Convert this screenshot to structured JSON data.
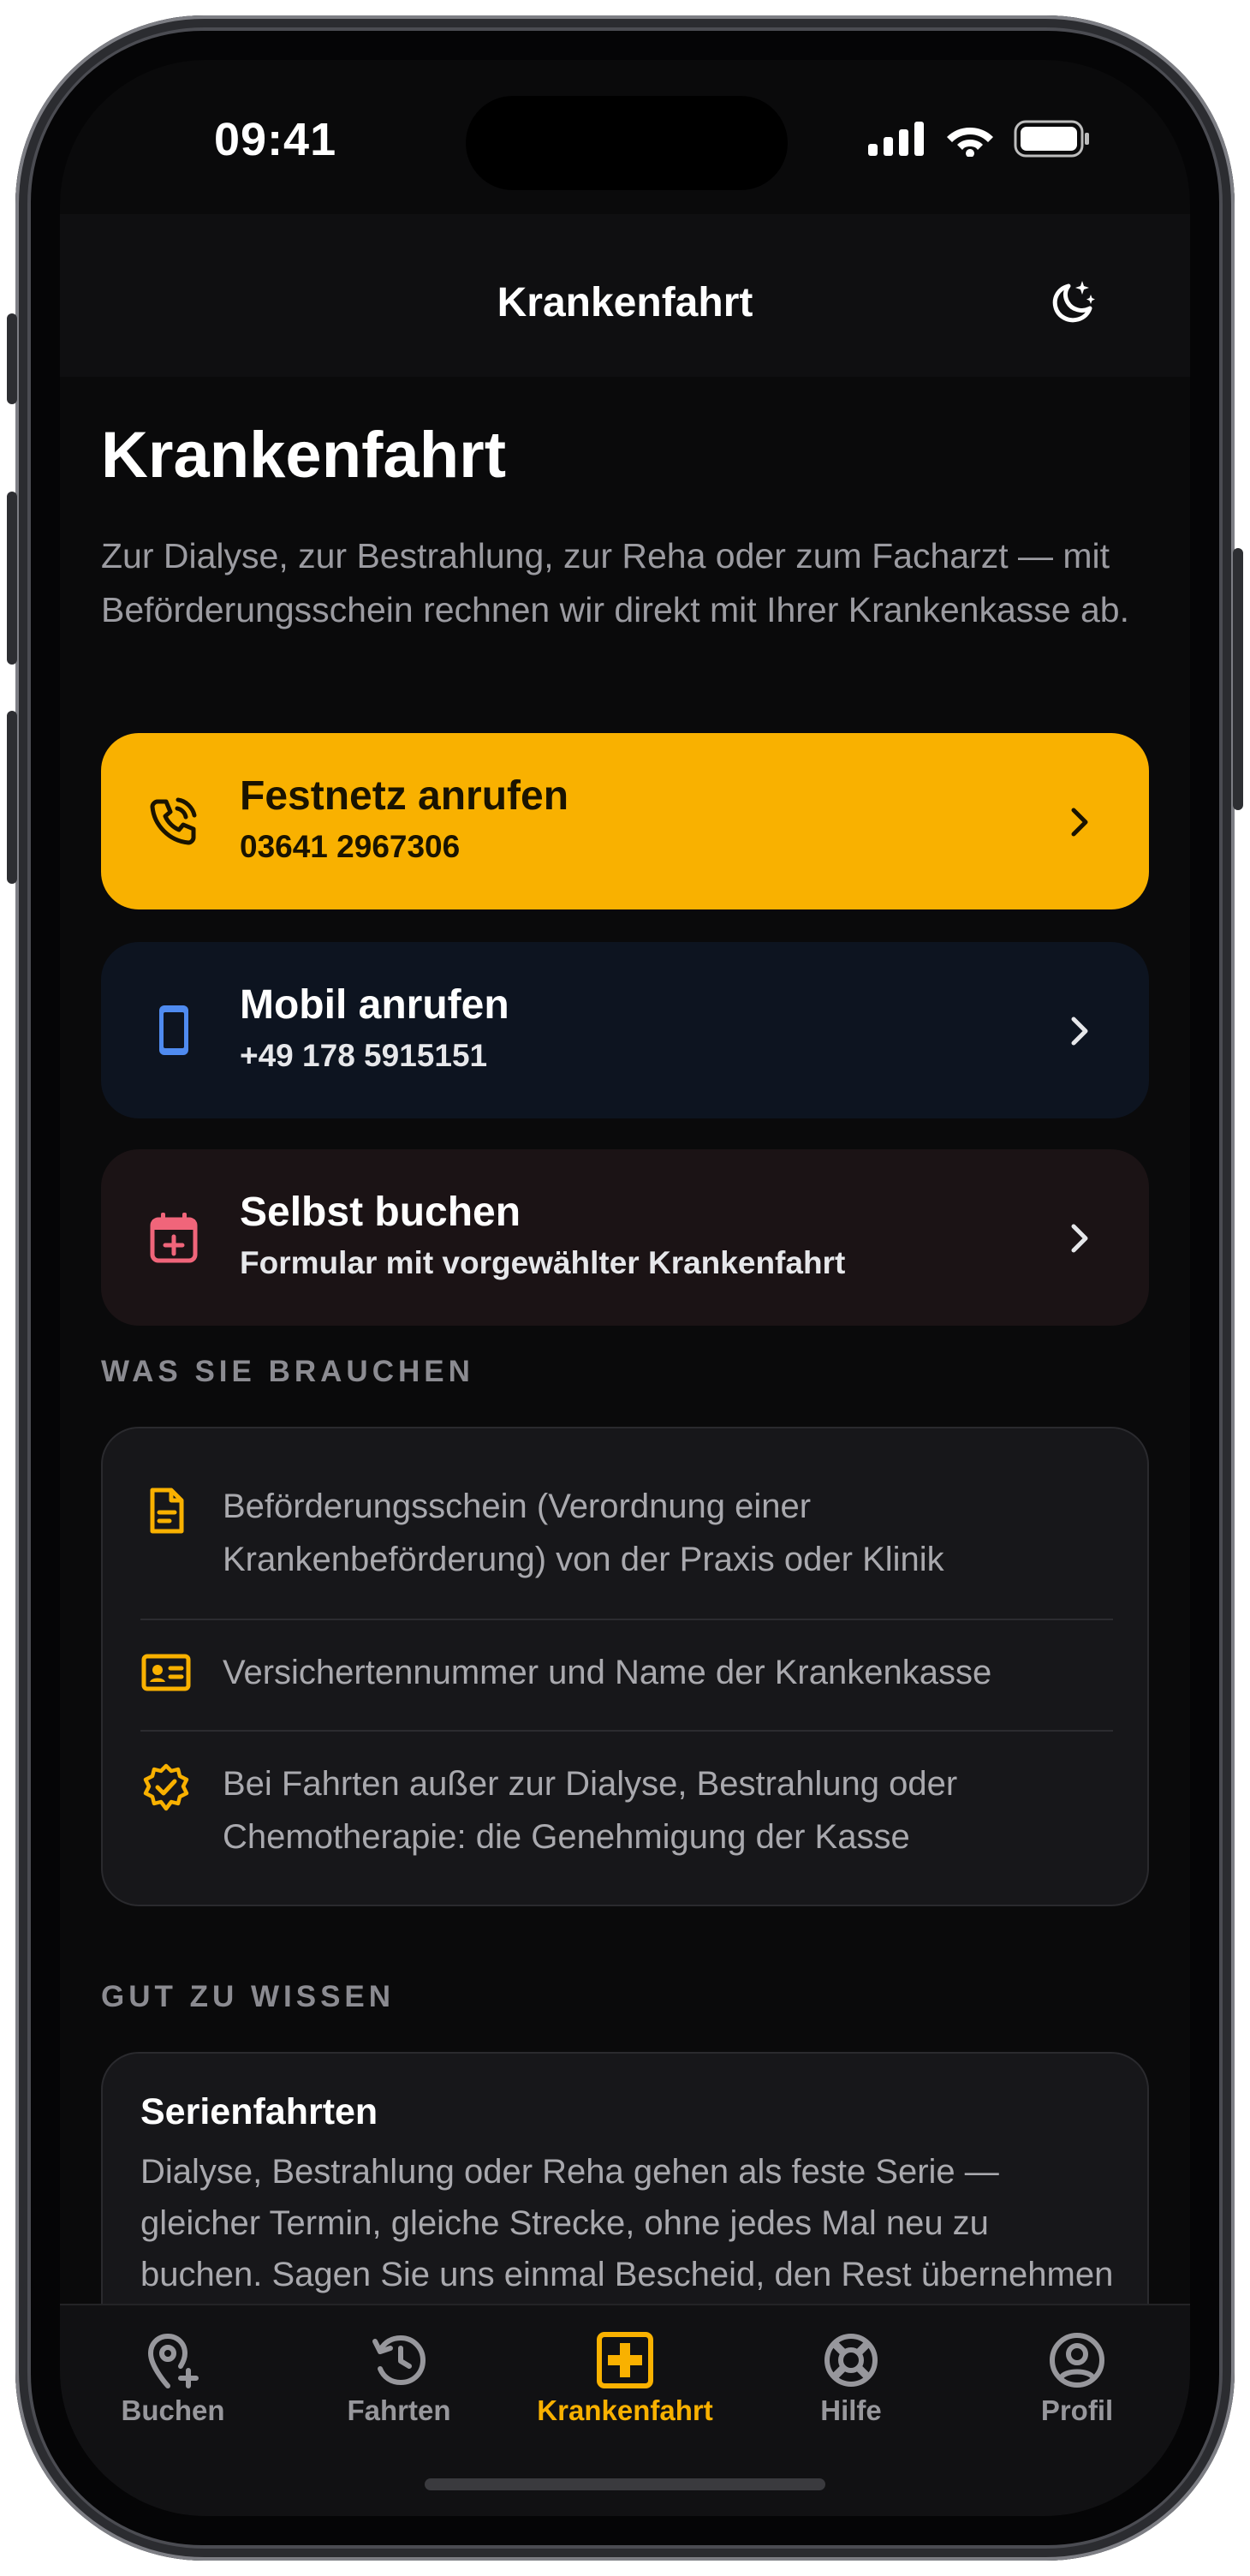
{
  "status": {
    "time": "09:41"
  },
  "nav": {
    "title": "Krankenfahrt",
    "theme_icon": "moon-stars-icon"
  },
  "page": {
    "heading": "Krankenfahrt",
    "lead": "Zur Dialyse, zur Bestrahlung, zur Reha oder zum Facharzt — mit Beförderungsschein rechnen wir direkt mit Ihrer Krankenkasse ab."
  },
  "actions": [
    {
      "title": "Festnetz anrufen",
      "subtitle": "03641 2967306",
      "icon": "phone-icon",
      "color": "#f9b100"
    },
    {
      "title": "Mobil anrufen",
      "subtitle": "+49 178 5915151",
      "icon": "smartphone-icon",
      "color": "#4f8bf0"
    },
    {
      "title": "Selbst buchen",
      "subtitle": "Formular mit vorgewählter Krankenfahrt",
      "icon": "calendar-plus-icon",
      "color": "#f0657a"
    }
  ],
  "needs": {
    "heading": "WAS SIE BRAUCHEN",
    "items": [
      {
        "text": "Beförderungsschein (Verordnung einer Krankenbeförderung) von der Praxis oder Klinik",
        "icon": "document-icon"
      },
      {
        "text": "Versichertennummer und Name der Krankenkasse",
        "icon": "id-card-icon"
      },
      {
        "text": "Bei Fahrten außer zur Dialyse, Bestrahlung oder Chemotherapie: die Genehmigung der Kasse",
        "icon": "verified-badge-icon"
      }
    ]
  },
  "info": {
    "heading": "GUT ZU WISSEN",
    "card_title": "Serienfahrten",
    "card_text": "Dialyse, Bestrahlung oder Reha gehen als feste Serie — gleicher Termin, gleiche Strecke, ohne jedes Mal neu zu buchen. Sagen Sie uns einmal Bescheid, den Rest übernehmen wir."
  },
  "tabs": [
    {
      "label": "Buchen",
      "icon": "map-pin-plus-icon"
    },
    {
      "label": "Fahrten",
      "icon": "history-icon"
    },
    {
      "label": "Krankenfahrt",
      "icon": "medical-cross-icon",
      "active": true
    },
    {
      "label": "Hilfe",
      "icon": "lifebuoy-icon"
    },
    {
      "label": "Profil",
      "icon": "user-circle-icon"
    }
  ],
  "colors": {
    "accent": "#f9b100",
    "background": "#0a0a0b",
    "card": "#17171a"
  }
}
